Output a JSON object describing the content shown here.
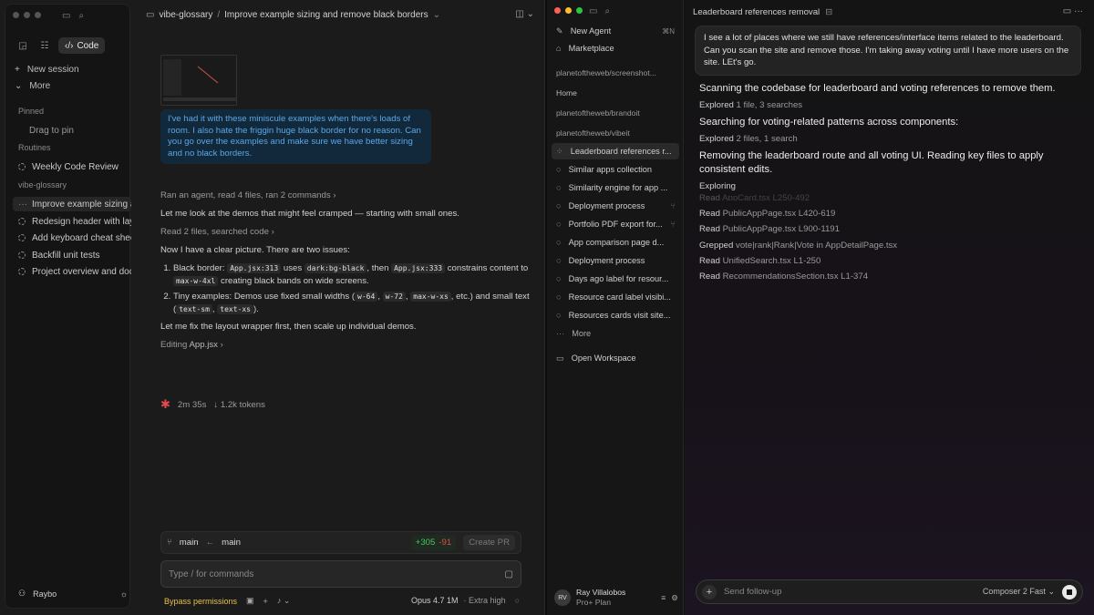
{
  "left_window": {
    "sidebar": {
      "mode_code_label": "Code",
      "new_session": "New session",
      "more": "More",
      "pinned_heading": "Pinned",
      "drag_to_pin": "Drag to pin",
      "routines_heading": "Routines",
      "routine_1": "Weekly Code Review",
      "project_heading": "vibe-glossary",
      "sessions": [
        "Improve example sizing and remove black borders",
        "Redesign header with layout",
        "Add keyboard cheat sheet",
        "Backfill unit tests",
        "Project overview and docs"
      ],
      "user_name": "Raybo"
    },
    "main": {
      "breadcrumb_project": "vibe-glossary",
      "breadcrumb_separator": "/",
      "breadcrumb_title": "Improve example sizing and remove black borders",
      "user_message": "I've had it with these miniscule examples when there's loads of room. I also hate the friggin huge black border for no reason. Can you go over the examples and make sure we have better sizing and no black borders.",
      "activity_1": "Ran an agent, read 4 files, ran 2 commands",
      "line_1": "Let me look at the demos that might feel cramped — starting with small ones.",
      "activity_2": "Read 2 files, searched code",
      "line_2": "Now I have a clear picture. There are two issues:",
      "issue_1": {
        "label": "Black border: ",
        "code_1": "App.jsx:313",
        "t1": " uses ",
        "code_2": "dark:bg-black",
        "t2": ", then ",
        "code_3": "App.jsx:333",
        "t3": " constrains content to ",
        "code_4": "max-w-4xl",
        "t4": " creating black bands on wide screens."
      },
      "issue_2": {
        "label": "Tiny examples: Demos use fixed small widths (",
        "code_1": "w-64",
        "t1": ", ",
        "code_2": "w-72",
        "t2": ", ",
        "code_3": "max-w-xs",
        "t3": ", etc.) and small text (",
        "code_4": "text-sm",
        "t4": ", ",
        "code_5": "text-xs",
        "t5": ")."
      },
      "line_3": "Let me fix the layout wrapper first, then scale up individual demos.",
      "editing_label": "Editing",
      "editing_file": "App.jsx",
      "status_time": "2m 35s",
      "status_tokens": "↓ 1.2k tokens",
      "branch_from": "main",
      "branch_to": "main",
      "additions": "+305",
      "deletions": "-91",
      "create_pr": "Create PR",
      "input_placeholder": "Type / for commands",
      "bypass_permissions": "Bypass permissions",
      "model": "Opus 4.7 1M",
      "effort": "· Extra high"
    }
  },
  "right_window": {
    "sidebar": {
      "new_agent": "New Agent",
      "new_agent_shortcut": "⌘N",
      "marketplace": "Marketplace",
      "workspace_1": "planetoftheweb/screenshot...",
      "home": "Home",
      "workspace_2": "planetoftheweb/brandoit",
      "workspace_3": "planetoftheweb/vibeit",
      "agents": [
        "Leaderboard references r...",
        "Similar apps collection",
        "Similarity engine for app ...",
        "Deployment process",
        "Portfolio PDF export for...",
        "App comparison page d...",
        "Deployment process",
        "Days ago label for resour...",
        "Resource card label visibi...",
        "Resources cards visit site..."
      ],
      "more": "More",
      "open_workspace": "Open Workspace",
      "user_initials": "RV",
      "user_name": "Ray Villalobos",
      "user_plan": "Pro+ Plan"
    },
    "main": {
      "title": "Leaderboard references removal",
      "user_message": "I see a lot of places where we still have references/interface items related to the leaderboard. Can you scan the site and remove those. I'm taking away voting until I have more users on the site. LEt's go.",
      "step_1": "Scanning the codebase for leaderboard and voting references to remove them.",
      "explored_1_label": "Explored",
      "explored_1_detail": "1 file, 3 searches",
      "step_2": "Searching for voting-related patterns across components:",
      "explored_2_label": "Explored",
      "explored_2_detail": "2 files, 1 search",
      "step_3": "Removing the leaderboard route and all voting UI. Reading key files to apply consistent edits.",
      "exploring": "Exploring",
      "reads": [
        {
          "verb": "Read",
          "detail": "AppCard.tsx L250-492"
        },
        {
          "verb": "Read",
          "detail": "PublicAppPage.tsx L420-619"
        },
        {
          "verb": "Read",
          "detail": "PublicAppPage.tsx L900-1191"
        },
        {
          "verb": "Grepped",
          "detail": "vote|rank|Rank|Vote in AppDetailPage.tsx"
        },
        {
          "verb": "Read",
          "detail": "UnifiedSearch.tsx L1-250"
        },
        {
          "verb": "Read",
          "detail": "RecommendationsSection.tsx L1-374"
        }
      ],
      "input_placeholder": "Send follow-up",
      "model": "Composer 2 Fast"
    }
  },
  "colors": {
    "accent_link": "#5aa8e8",
    "bubble_bg": "#12283b",
    "additions": "#4cc36a",
    "deletions": "#e5484d",
    "bypass": "#e8c24a",
    "asterisk": "#e5484d"
  },
  "icons": [
    "sidebar-toggle-icon",
    "search-icon",
    "chat-icon",
    "tasks-icon",
    "code-icon",
    "plus-icon",
    "chevron-down-icon",
    "folder-icon",
    "branch-icon",
    "arrow-left-icon",
    "square-icon",
    "mic-icon",
    "sun-icon",
    "user-icon",
    "filter-icon",
    "gear-icon",
    "stop-icon",
    "workspace-icon",
    "agent-icon",
    "store-icon"
  ]
}
